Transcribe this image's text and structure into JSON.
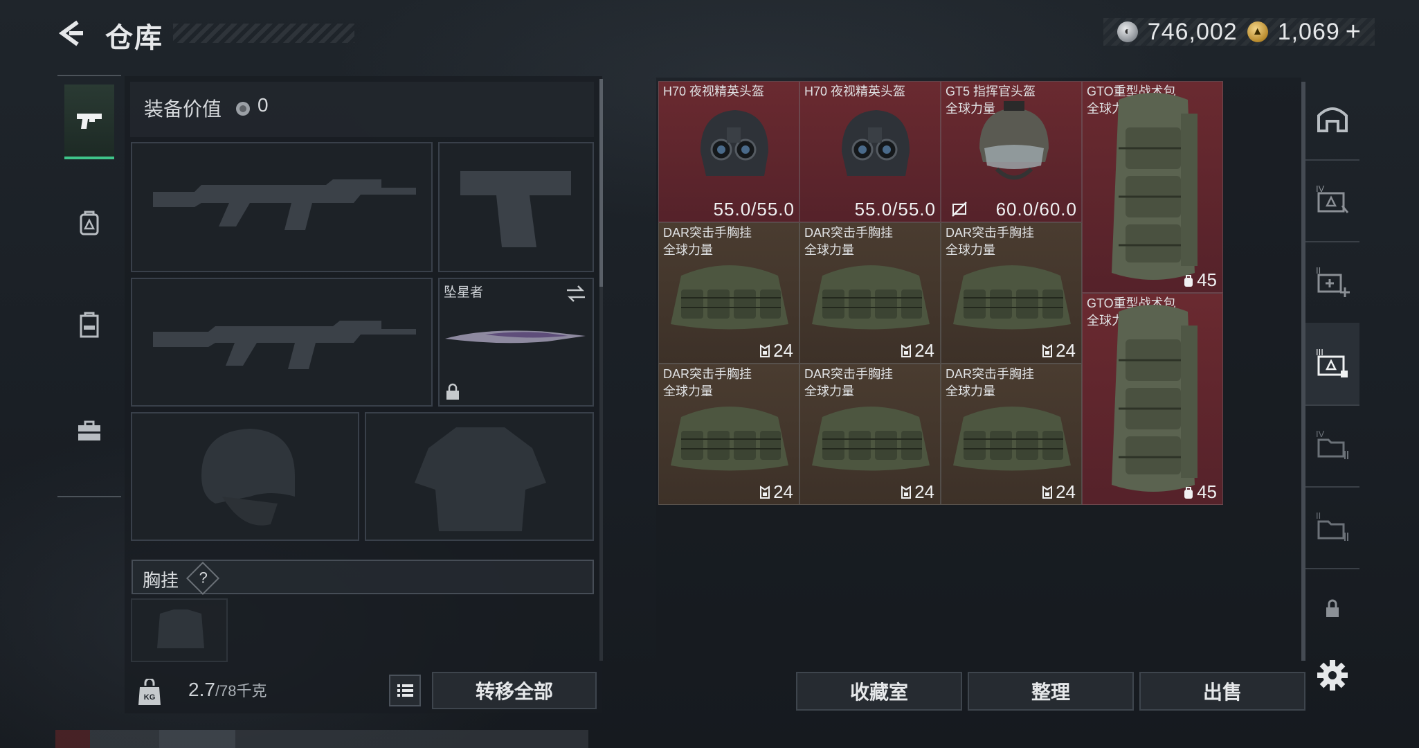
{
  "header": {
    "title": "仓库",
    "back_icon": "chevron-left-icon",
    "currency": [
      {
        "icon": "silver-coin-icon",
        "value": "746,002"
      },
      {
        "icon": "gold-coin-icon",
        "value": "1,069"
      }
    ],
    "add_label": "+"
  },
  "left_nav": [
    {
      "icon": "pistol-icon",
      "active": true
    },
    {
      "icon": "backpack-icon",
      "active": false
    },
    {
      "icon": "vest-icon",
      "active": false
    },
    {
      "icon": "toolbox-icon",
      "active": false
    }
  ],
  "equipment": {
    "value_label": "装备价值",
    "value": "0",
    "melee_name": "坠星者",
    "vest_label": "胸挂",
    "help_label": "?",
    "weight_value": "2.7",
    "weight_capacity": "/78千克",
    "transfer_all_label": "转移全部"
  },
  "inventory": {
    "cells": [
      {
        "name": "H70 夜视精英头盔",
        "sub": "",
        "type": "helmet-nv",
        "stat": "55.0/55.0",
        "rarity": "red"
      },
      {
        "name": "H70 夜视精英头盔",
        "sub": "",
        "type": "helmet-nv",
        "stat": "55.0/55.0",
        "rarity": "red"
      },
      {
        "name": "GT5 指挥官头盔",
        "sub": "全球力量",
        "type": "helmet-cmd",
        "stat": "60.0/60.0",
        "rarity": "red"
      },
      {
        "name": "GTO重型战术包",
        "sub": "全球力量",
        "type": "backpack",
        "stat": "45",
        "rarity": "red"
      },
      {
        "name": "DAR突击手胸挂",
        "sub": "全球力量",
        "type": "rig",
        "stat": "24",
        "rarity": "brown"
      },
      {
        "name": "DAR突击手胸挂",
        "sub": "全球力量",
        "type": "rig",
        "stat": "24",
        "rarity": "brown"
      },
      {
        "name": "DAR突击手胸挂",
        "sub": "全球力量",
        "type": "rig",
        "stat": "24",
        "rarity": "brown"
      },
      {
        "name": "GTO重型战术包",
        "sub": "全球力量",
        "type": "backpack",
        "stat": "45",
        "rarity": "red"
      },
      {
        "name": "DAR突击手胸挂",
        "sub": "全球力量",
        "type": "rig",
        "stat": "24",
        "rarity": "brown"
      },
      {
        "name": "DAR突击手胸挂",
        "sub": "全球力量",
        "type": "rig",
        "stat": "24",
        "rarity": "brown"
      },
      {
        "name": "DAR突击手胸挂",
        "sub": "全球力量",
        "type": "rig",
        "stat": "24",
        "rarity": "brown"
      }
    ]
  },
  "right_nav": [
    {
      "icon": "safehouse-icon"
    },
    {
      "icon": "storage-iv-icon"
    },
    {
      "icon": "storage-ii-add-icon"
    },
    {
      "icon": "storage-iii-active-icon"
    },
    {
      "icon": "storage-iv-folder-icon"
    },
    {
      "icon": "storage-ii-folder-icon"
    },
    {
      "icon": "lock-icon"
    }
  ],
  "actions": {
    "collection_label": "收藏室",
    "sort_label": "整理",
    "sell_label": "出售"
  },
  "colors": {
    "accent": "#3fc48a",
    "rare_red": "#6a2a30",
    "common_brown": "#4a3c30"
  }
}
